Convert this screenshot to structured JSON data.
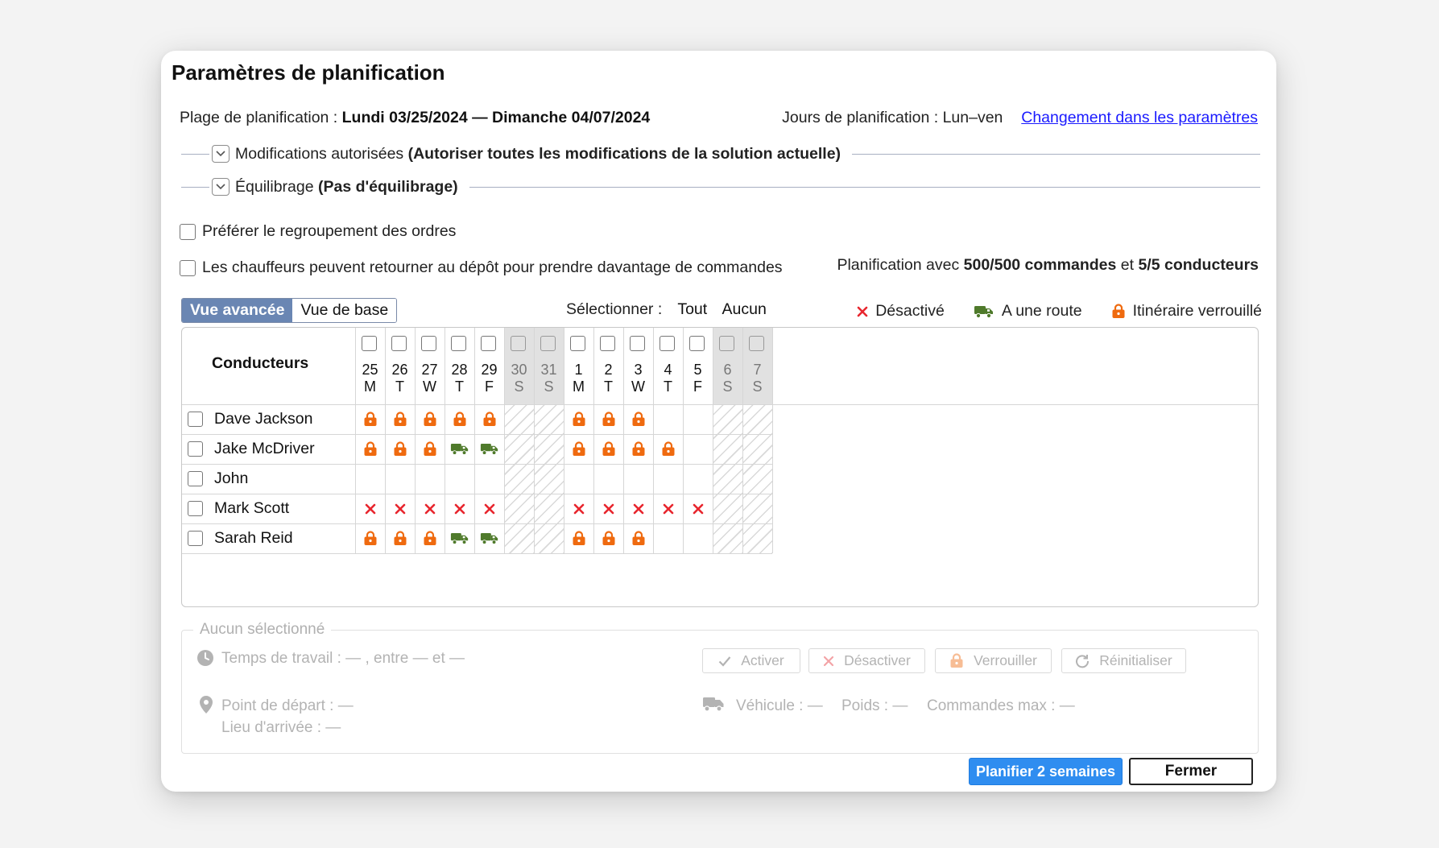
{
  "dialog": {
    "title": "Paramètres de planification",
    "range_label": "Plage de planification :",
    "range_value": "Lundi 03/25/2024 — Dimanche 04/07/2024",
    "days_label": "Jours de planification : Lun–ven",
    "change_link": "Changement dans les paramètres",
    "sections": [
      {
        "label": "Modifications autorisées",
        "value": "(Autoriser toutes les modifications de la solution actuelle)"
      },
      {
        "label": "Équilibrage",
        "value": "(Pas d'équilibrage)"
      }
    ],
    "options": [
      {
        "label": "Préférer le regroupement des ordres",
        "checked": false
      },
      {
        "label": "Les chauffeurs peuvent retourner au dépôt pour prendre davantage de commandes",
        "checked": false
      }
    ],
    "stats": {
      "prefix": "Planification avec",
      "orders": "500/500 commandes",
      "middle": "et",
      "drivers": "5/5 conducteurs"
    }
  },
  "view_toggle": {
    "advanced": "Vue avancée",
    "basic": "Vue de base",
    "active": "advanced"
  },
  "select": {
    "label": "Sélectionner :",
    "all": "Tout",
    "none": "Aucun"
  },
  "legend": {
    "disabled": "Désactivé",
    "has_route": "A une route",
    "locked": "Itinéraire verrouillé"
  },
  "colors": {
    "accent": "#6a86b3",
    "lock": "#ef6a0f",
    "truck": "#4f7a2b",
    "disabled_x": "#e8262e",
    "primary_button": "#2f8df0"
  },
  "grid": {
    "drivers_header": "Conducteurs",
    "days": [
      {
        "num": "25",
        "wd": "M",
        "weekend": false
      },
      {
        "num": "26",
        "wd": "T",
        "weekend": false
      },
      {
        "num": "27",
        "wd": "W",
        "weekend": false
      },
      {
        "num": "28",
        "wd": "T",
        "weekend": false
      },
      {
        "num": "29",
        "wd": "F",
        "weekend": false
      },
      {
        "num": "30",
        "wd": "S",
        "weekend": true
      },
      {
        "num": "31",
        "wd": "S",
        "weekend": true
      },
      {
        "num": "1",
        "wd": "M",
        "weekend": false
      },
      {
        "num": "2",
        "wd": "T",
        "weekend": false
      },
      {
        "num": "3",
        "wd": "W",
        "weekend": false
      },
      {
        "num": "4",
        "wd": "T",
        "weekend": false
      },
      {
        "num": "5",
        "wd": "F",
        "weekend": false
      },
      {
        "num": "6",
        "wd": "S",
        "weekend": true
      },
      {
        "num": "7",
        "wd": "S",
        "weekend": true
      }
    ],
    "drivers": [
      {
        "name": "Dave Jackson",
        "cells": [
          "lock",
          "lock",
          "lock",
          "lock",
          "lock",
          "",
          "",
          "lock",
          "lock",
          "lock",
          "",
          "",
          "",
          ""
        ]
      },
      {
        "name": "Jake McDriver",
        "cells": [
          "lock",
          "lock",
          "lock",
          "truck",
          "truck",
          "",
          "",
          "lock",
          "lock",
          "lock",
          "lock",
          "",
          "",
          ""
        ]
      },
      {
        "name": "John",
        "cells": [
          "",
          "",
          "",
          "",
          "",
          "",
          "",
          "",
          "",
          "",
          "",
          "",
          "",
          ""
        ]
      },
      {
        "name": "Mark Scott",
        "cells": [
          "x",
          "x",
          "x",
          "x",
          "x",
          "",
          "",
          "x",
          "x",
          "x",
          "x",
          "x",
          "",
          ""
        ]
      },
      {
        "name": "Sarah Reid",
        "cells": [
          "lock",
          "lock",
          "lock",
          "truck",
          "truck",
          "",
          "",
          "lock",
          "lock",
          "lock",
          "",
          "",
          "",
          ""
        ]
      }
    ]
  },
  "details": {
    "title": "Aucun sélectionné",
    "work_time": "Temps de travail :  —  , entre   —   et   —",
    "start_point": "Point de départ :     —",
    "end_point": "Lieu d'arrivée :       —",
    "vehicle": "Véhicule :   —",
    "weight": "Poids :   —",
    "max_orders": "Commandes max :   —",
    "buttons": {
      "activate": "Activer",
      "deactivate": "Désactiver",
      "lock": "Verrouiller",
      "reset": "Réinitialiser"
    }
  },
  "footer": {
    "plan": "Planifier 2 semaines",
    "close": "Fermer"
  }
}
